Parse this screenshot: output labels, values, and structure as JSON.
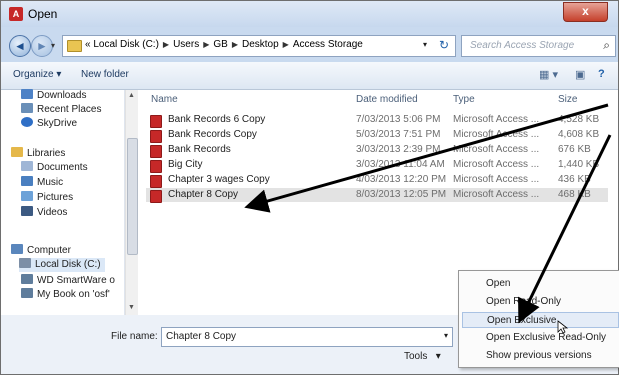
{
  "window": {
    "title": "Open",
    "close_glyph": "x",
    "app_icon_label": "A"
  },
  "nav": {
    "back_glyph": "◄",
    "forward_glyph": "►",
    "breadcrumbs": [
      "Local Disk (C:)",
      "Users",
      "GB",
      "Desktop",
      "Access Storage"
    ],
    "search_placeholder": "Search Access Storage"
  },
  "toolbar": {
    "organize_label": "Organize ▾",
    "new_folder_label": "New folder"
  },
  "sidebar": {
    "items": [
      {
        "label": "Downloads",
        "icon": "downloads-icon",
        "color": "#4e82c6"
      },
      {
        "label": "Recent Places",
        "icon": "recent-places-icon",
        "color": "#6a8fb8"
      },
      {
        "label": "SkyDrive",
        "icon": "skydrive-icon",
        "color": "#2f6fc6"
      },
      {
        "label": "Libraries",
        "icon": "libraries-icon",
        "color": "#e5b84a"
      },
      {
        "label": "Documents",
        "icon": "documents-icon",
        "color": "#9fb6d6"
      },
      {
        "label": "Music",
        "icon": "music-icon",
        "color": "#4a7fc0"
      },
      {
        "label": "Pictures",
        "icon": "pictures-icon",
        "color": "#6da2d8"
      },
      {
        "label": "Videos",
        "icon": "videos-icon",
        "color": "#3c5a82"
      },
      {
        "label": "Computer",
        "icon": "computer-icon",
        "color": "#5a86bc"
      },
      {
        "label": "Local Disk (C:)",
        "icon": "local-disk-icon",
        "color": "#7d8fa6"
      },
      {
        "label": "WD SmartWare o",
        "icon": "network-drive-icon",
        "color": "#5f7d9c"
      },
      {
        "label": "My Book on 'osf'",
        "icon": "network-drive-icon",
        "color": "#5f7d9c"
      }
    ]
  },
  "filelist": {
    "columns": [
      "Name",
      "Date modified",
      "Type",
      "Size"
    ],
    "rows": [
      {
        "name": "Bank Records 6 Copy",
        "date": "7/03/2013 5:06 PM",
        "type": "Microsoft Access ...",
        "size": "4,528 KB"
      },
      {
        "name": "Bank Records Copy",
        "date": "5/03/2013 7:51 PM",
        "type": "Microsoft Access ...",
        "size": "4,608 KB"
      },
      {
        "name": "Bank Records",
        "date": "3/03/2013 2:39 PM",
        "type": "Microsoft Access ...",
        "size": "676 KB"
      },
      {
        "name": "Big City",
        "date": "3/03/2013 11:04 AM",
        "type": "Microsoft Access ...",
        "size": "1,440 KB"
      },
      {
        "name": "Chapter 3 wages Copy",
        "date": "4/03/2013 12:20 PM",
        "type": "Microsoft Access ...",
        "size": "436 KB"
      },
      {
        "name": "Chapter 8 Copy",
        "date": "8/03/2013 12:05 PM",
        "type": "Microsoft Access ...",
        "size": "468 KB"
      }
    ]
  },
  "bottom": {
    "file_name_label": "File name:",
    "file_name_value": "Chapter 8 Copy",
    "tools_label": "Tools",
    "dropdown_glyph": "▾"
  },
  "open_menu": {
    "items": [
      "Open",
      "Open Read-Only",
      "Open Exclusive",
      "Open Exclusive Read-Only",
      "Show previous versions"
    ],
    "highlighted_index": 2
  }
}
